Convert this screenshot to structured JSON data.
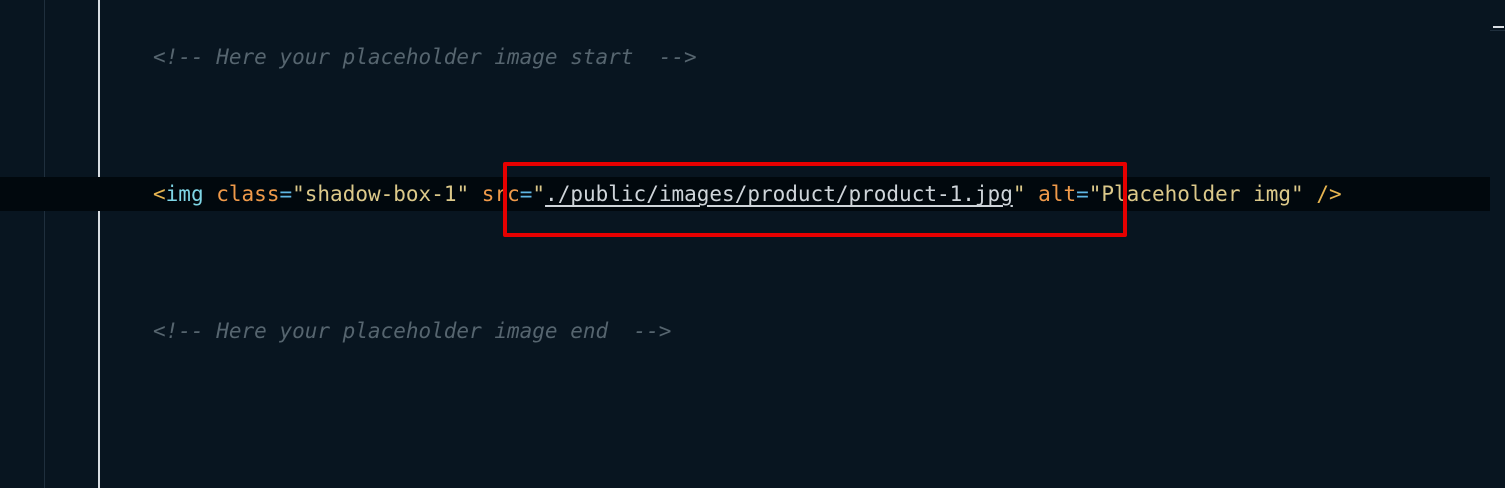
{
  "editor": {
    "lines": {
      "comment_start": "<!-- Here your placeholder image start  -->",
      "comment_end": "<!-- Here your placeholder image end  -->",
      "img": {
        "open_bracket": "<",
        "tag": "img",
        "class_attr": "class",
        "equals1": "=",
        "class_value": "\"shadow-box-1\"",
        "src_attr": "src",
        "equals2": "=",
        "quote_open": "\"",
        "src_value": "./public/images/product/product-1.jpg",
        "quote_close": "\"",
        "alt_attr": "alt",
        "equals3": "=",
        "alt_value": "\"Placeholder img\"",
        "close": "/>"
      }
    },
    "highlight_color": "#e60000"
  }
}
